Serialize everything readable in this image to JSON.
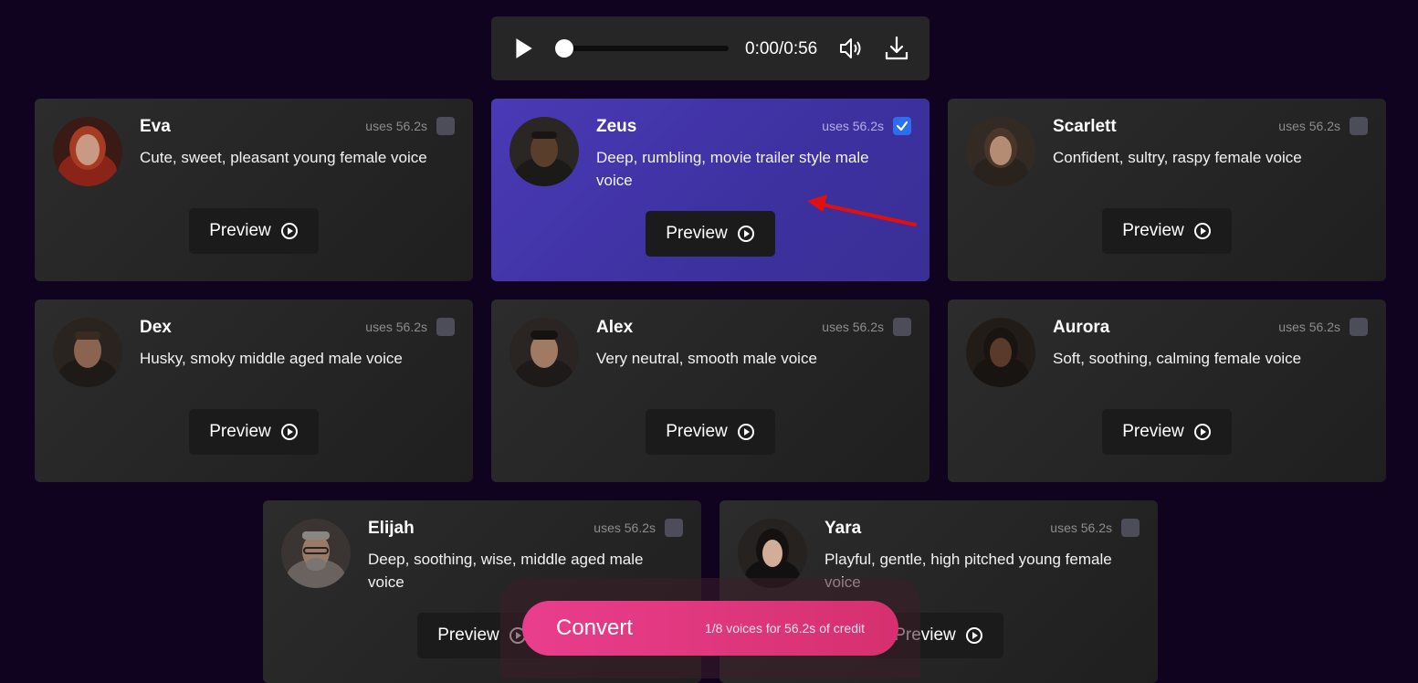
{
  "player": {
    "time": "0:00/0:56",
    "progress": 0
  },
  "voices": [
    {
      "name": "Eva",
      "description": "Cute, sweet, pleasant young female voice",
      "uses": "uses 56.2s",
      "checked": false,
      "preview_label": "Preview"
    },
    {
      "name": "Zeus",
      "description": "Deep, rumbling, movie trailer style male voice",
      "uses": "uses 56.2s",
      "checked": true,
      "preview_label": "Preview"
    },
    {
      "name": "Scarlett",
      "description": "Confident, sultry, raspy female voice",
      "uses": "uses 56.2s",
      "checked": false,
      "preview_label": "Preview"
    },
    {
      "name": "Dex",
      "description": "Husky, smoky middle aged male voice",
      "uses": "uses 56.2s",
      "checked": false,
      "preview_label": "Preview"
    },
    {
      "name": "Alex",
      "description": "Very neutral, smooth male voice",
      "uses": "uses 56.2s",
      "checked": false,
      "preview_label": "Preview"
    },
    {
      "name": "Aurora",
      "description": "Soft, soothing, calming female voice",
      "uses": "uses 56.2s",
      "checked": false,
      "preview_label": "Preview"
    },
    {
      "name": "Elijah",
      "description": "Deep, soothing, wise, middle aged male voice",
      "uses": "uses 56.2s",
      "checked": false,
      "preview_label": "Preview"
    },
    {
      "name": "Yara",
      "description": "Playful, gentle, high pitched young female voice",
      "uses": "uses 56.2s",
      "checked": false,
      "preview_label": "Preview"
    }
  ],
  "convert": {
    "label": "Convert",
    "summary": "1/8 voices for 56.2s of credit"
  },
  "colors": {
    "background": "#10031f",
    "card": "#262626",
    "selected_card": "#4236a8",
    "checkbox_on": "#2f6df0",
    "convert": "#e33a85",
    "annotation_arrow": "#e01010"
  },
  "icons": [
    "play-icon",
    "volume-icon",
    "download-icon",
    "play-circle-icon",
    "check-icon"
  ]
}
